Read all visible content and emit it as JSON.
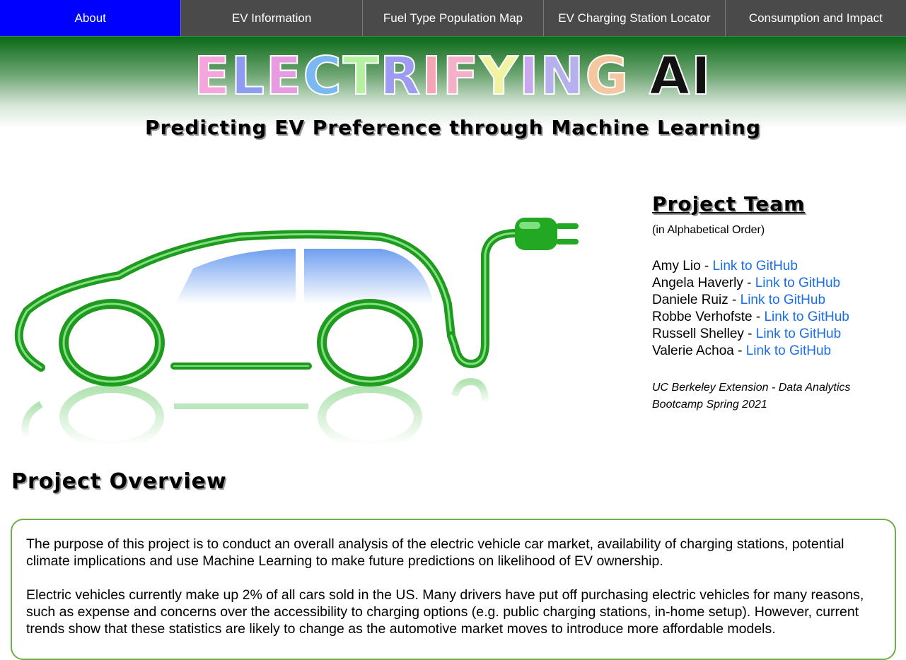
{
  "nav": {
    "items": [
      {
        "label": "About",
        "active": true
      },
      {
        "label": "EV Information",
        "active": false
      },
      {
        "label": "Fuel Type Population Map",
        "active": false
      },
      {
        "label": "EV Charging Station Locator",
        "active": false
      },
      {
        "label": "Consumption and Impact",
        "active": false
      }
    ],
    "active_color": "#0000ff"
  },
  "header": {
    "title_letters": [
      "E",
      "L",
      "E",
      "C",
      "T",
      "R",
      "I",
      "F",
      "Y",
      "I",
      "N",
      "G",
      " ",
      "A",
      "I"
    ],
    "title_colors": [
      "#f4a6dc",
      "#8f9bf0",
      "#e79be0",
      "#79b8f2",
      "#b5f2a0",
      "#9e9cf2",
      "#f4a4b4",
      "#f4b0c8",
      "#f0f4a0",
      "#caa8f0",
      "#b6b0ee",
      "#f4c7a0",
      "#ffffff",
      "#111111",
      "#111111"
    ],
    "subtitle": "Predicting EV Preference through Machine Learning"
  },
  "hero": {
    "image": "green-electric-car-with-plug-icon"
  },
  "team": {
    "title": "Project Team",
    "subtitle": "(in Alphabetical Order)",
    "members": [
      {
        "name": "Amy Lio",
        "link": "Link to GitHub"
      },
      {
        "name": "Angela Haverly",
        "link": "Link to GitHub"
      },
      {
        "name": "Daniele Ruiz",
        "link": "Link to GitHub"
      },
      {
        "name": "Robbe Verhofste",
        "link": "Link to GitHub"
      },
      {
        "name": "Russell Shelley",
        "link": "Link to GitHub"
      },
      {
        "name": "Valerie Achoa",
        "link": "Link to GitHub"
      }
    ],
    "affiliation_line1": "UC Berkeley Extension - Data Analytics",
    "affiliation_line2": "Bootcamp Spring 2021"
  },
  "overview": {
    "title": "Project Overview",
    "para1": "The purpose of this project is to conduct an overall analysis of the electric vehicle car market, availability of charging stations, potential climate implications and use Machine Learning to make future predictions on likelihood of EV ownership.",
    "para2": "Electric vehicles currently make up 2% of all cars sold in the US. Many drivers have put off purchasing electric vehicles for many reasons, such as expense and concerns over the accessibility to charging options (e.g. public charging stations, in-home setup). However, current trends show that these statistics are likely to change as the automotive market moves to introduce more affordable models."
  }
}
